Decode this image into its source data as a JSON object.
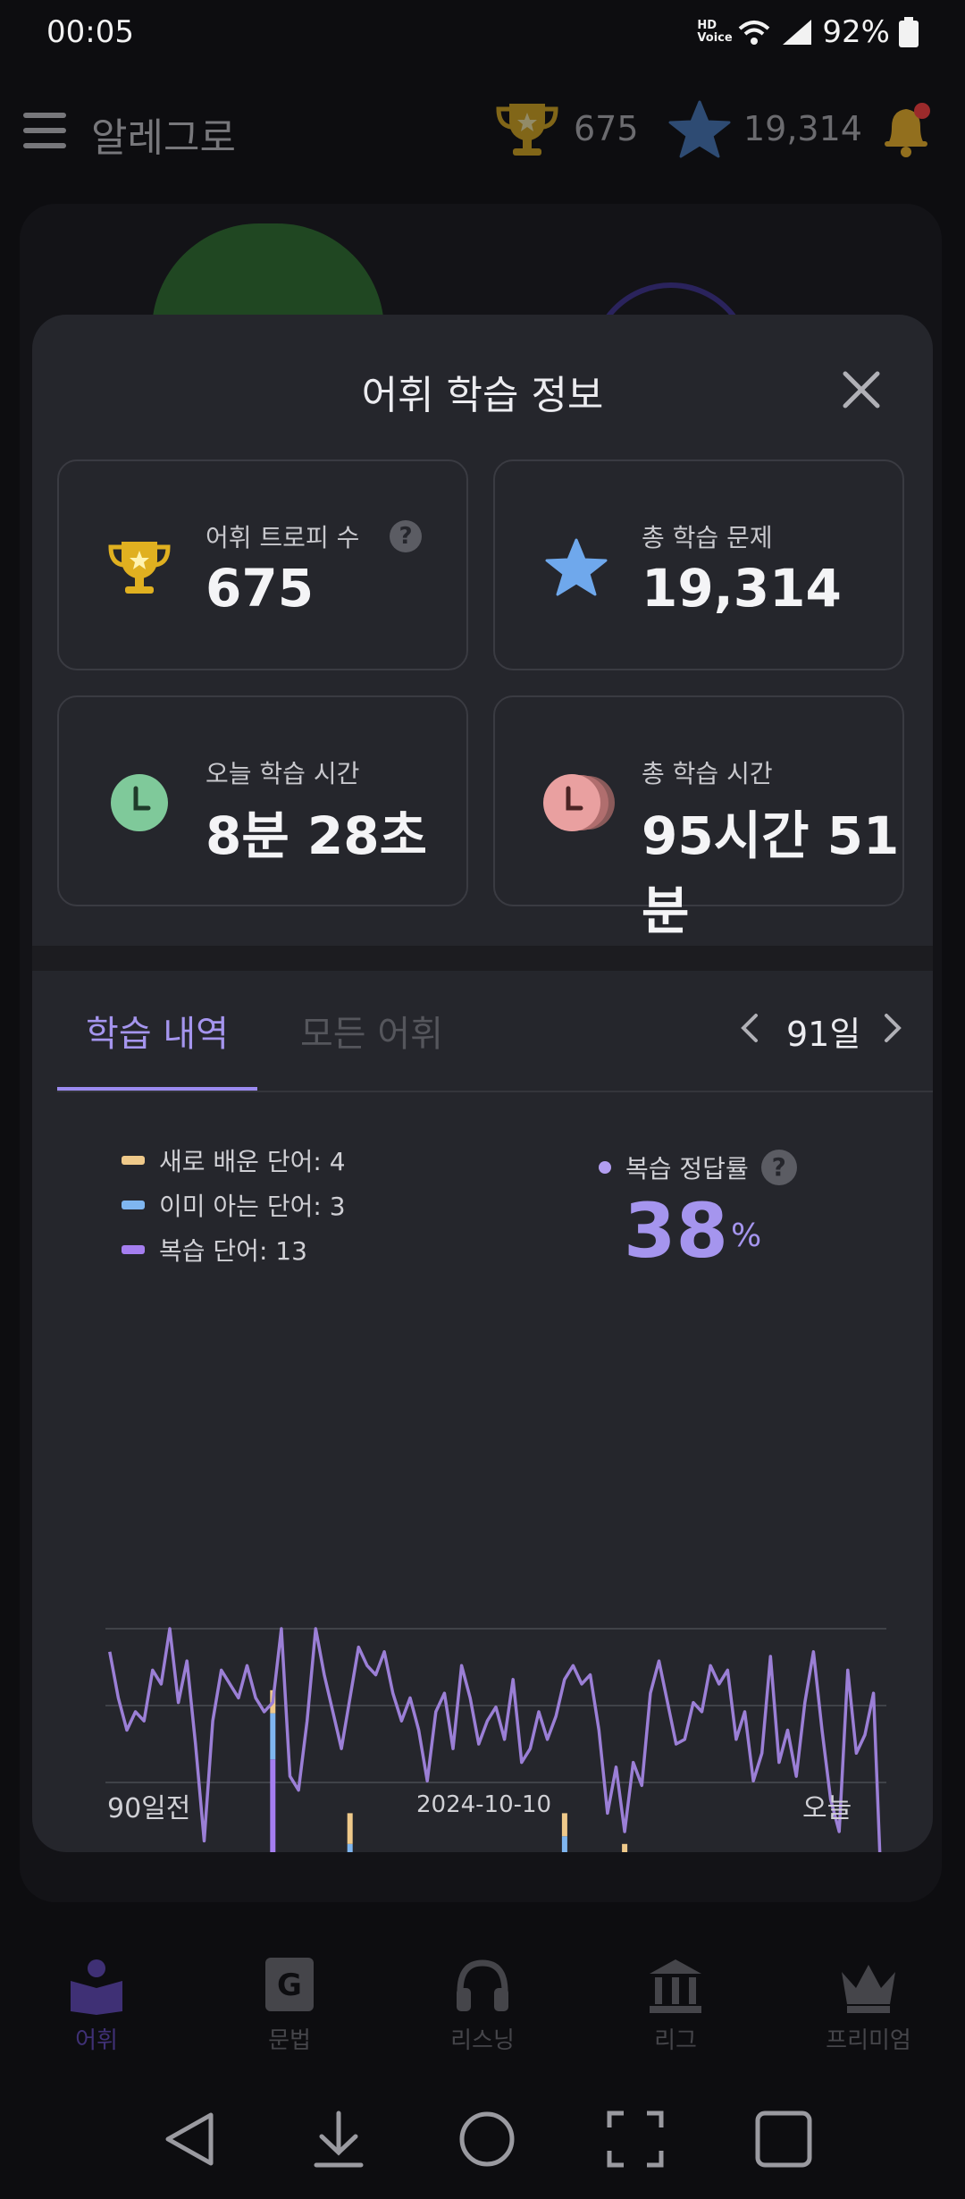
{
  "status_bar": {
    "time": "00:05",
    "network": "HD Voice",
    "battery": "92%"
  },
  "app_header": {
    "title": "알레그로",
    "trophies": "675",
    "stars": "19,314"
  },
  "modal": {
    "title": "어휘 학습 정보",
    "cards": [
      {
        "label": "어휘 트로피 수",
        "value": "675",
        "icon": "trophy-icon",
        "help": "?"
      },
      {
        "label": "총 학습 문제",
        "value": "19,314",
        "icon": "star-icon"
      },
      {
        "label": "오늘 학습 시간",
        "value": "8분 28초",
        "icon": "clock-icon"
      },
      {
        "label": "총 학습 시간",
        "value": "95시간 51분",
        "icon": "stacked-clock-icon"
      }
    ],
    "tabs": {
      "history": "학습 내역",
      "all_words": "모든 어휘"
    },
    "range": "91일",
    "legend": [
      {
        "label": "새로 배운 단어: 4",
        "color": "#efc98a"
      },
      {
        "label": "이미 아는 단어: 3",
        "color": "#7fb6f0"
      },
      {
        "label": "복습 단어: 13",
        "color": "#a57ef0"
      }
    ],
    "review_rate": {
      "label": "복습 정답률",
      "help": "?",
      "value": "38",
      "unit": "%"
    }
  },
  "chart_data": {
    "type": "bar+line",
    "x_start_label": "90일전",
    "x_mid_label": "2024-10-10",
    "x_end_label": "오늘",
    "days": 91,
    "bar_ylim": [
      0,
      60
    ],
    "line_ylim": [
      0,
      100
    ],
    "series": [
      {
        "name": "새로 배운 단어",
        "color": "#efc98a",
        "values": [
          3,
          4,
          4,
          2,
          1,
          2,
          2,
          0,
          3,
          3,
          3,
          0,
          3,
          2,
          0,
          4,
          2,
          0,
          1,
          3,
          1,
          1,
          4,
          4,
          1,
          2,
          0,
          2,
          4,
          2,
          2,
          2,
          0,
          3,
          2,
          3,
          2,
          4,
          2,
          2,
          4,
          3,
          4,
          2,
          2,
          2,
          3,
          1,
          2,
          0,
          2,
          3,
          2,
          3,
          3,
          4,
          3,
          0,
          2,
          3,
          4,
          4,
          4,
          3,
          3,
          2,
          3,
          3,
          4,
          4,
          2,
          3,
          2,
          3,
          0,
          3,
          2,
          3,
          4,
          2,
          4,
          4,
          1,
          1,
          1,
          3,
          4,
          3,
          4,
          3,
          4
        ]
      },
      {
        "name": "이미 아는 단어",
        "color": "#7fb6f0",
        "values": [
          4,
          4,
          3,
          2,
          1,
          2,
          2,
          2,
          2,
          3,
          3,
          2,
          3,
          3,
          2,
          3,
          2,
          2,
          4,
          6,
          3,
          2,
          4,
          3,
          2,
          3,
          2,
          2,
          4,
          2,
          2,
          4,
          3,
          3,
          2,
          3,
          3,
          3,
          2,
          3,
          3,
          3,
          3,
          2,
          2,
          2,
          2,
          3,
          2,
          4,
          3,
          3,
          2,
          3,
          2,
          4,
          2,
          2,
          2,
          3,
          6,
          3,
          6,
          6,
          2,
          3,
          2,
          4,
          3,
          3,
          3,
          2,
          2,
          2,
          3,
          3,
          2,
          3,
          3,
          3,
          3,
          3,
          3,
          2,
          4,
          5,
          3,
          4,
          3,
          3,
          3
        ]
      },
      {
        "name": "복습 단어",
        "color": "#a57ef0",
        "values": [
          11,
          11,
          18,
          14,
          8,
          8,
          8,
          8,
          14,
          8,
          14,
          8,
          8,
          11,
          5,
          8,
          11,
          8,
          13,
          43,
          8,
          8,
          8,
          12,
          8,
          8,
          8,
          9,
          28,
          9,
          8,
          8,
          8,
          11,
          10,
          12,
          13,
          8,
          11,
          11,
          12,
          10,
          10,
          12,
          11,
          4,
          12,
          11,
          10,
          11,
          13,
          14,
          10,
          30,
          8,
          14,
          8,
          10,
          10,
          12,
          22,
          18,
          10,
          11,
          10,
          10,
          10,
          20,
          12,
          18,
          10,
          11,
          14,
          12,
          16,
          19,
          11,
          17,
          10,
          11,
          8,
          12,
          10,
          9,
          14,
          10,
          18,
          13,
          12,
          10,
          11
        ]
      },
      {
        "name": "복습 정답률",
        "color": "#9b7fd6",
        "values": [
          95,
          85,
          78,
          82,
          80,
          91,
          88,
          100,
          84,
          93,
          75,
          54,
          80,
          91,
          88,
          85,
          92,
          85,
          82,
          84,
          100,
          68,
          65,
          80,
          100,
          90,
          82,
          74,
          85,
          96,
          92,
          90,
          95,
          86,
          80,
          85,
          78,
          67,
          82,
          86,
          74,
          92,
          85,
          75,
          80,
          83,
          76,
          89,
          71,
          74,
          82,
          76,
          81,
          89,
          92,
          88,
          90,
          78,
          60,
          70,
          56,
          71,
          66,
          86,
          93,
          84,
          75,
          76,
          84,
          82,
          92,
          88,
          91,
          76,
          82,
          67,
          73,
          94,
          71,
          78,
          68,
          84,
          95,
          78,
          63,
          56,
          91,
          73,
          77,
          86,
          39
        ]
      }
    ]
  },
  "bottom_nav": {
    "items": [
      "어휘",
      "문법",
      "리스닝",
      "리그",
      "프리미엄"
    ]
  }
}
